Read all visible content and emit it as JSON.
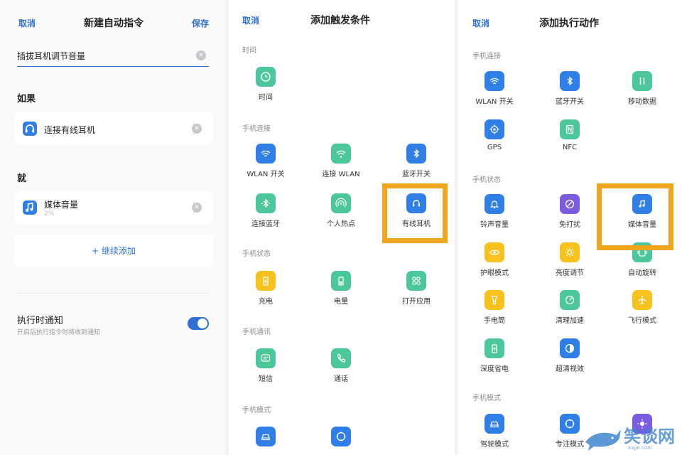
{
  "panel1": {
    "cancel": "取消",
    "title": "新建自动指令",
    "save": "保存",
    "command_name": "插拔耳机调节音量",
    "if_label": "如果",
    "trigger": {
      "label": "连接有线耳机"
    },
    "then_label": "就",
    "action": {
      "label": "媒体音量",
      "value": "2%"
    },
    "add_more": "+ 继续添加",
    "notify_title": "执行时通知",
    "notify_desc": "开启后执行指令时将收到通知",
    "notify_on": true
  },
  "panel2": {
    "cancel": "取消",
    "title": "添加触发条件",
    "sections": [
      {
        "name": "时间",
        "items": [
          {
            "label": "时间",
            "icon": "clock-icon",
            "color": "green"
          }
        ]
      },
      {
        "name": "手机连接",
        "items": [
          {
            "label": "WLAN 开关",
            "icon": "wifi-icon",
            "color": "blue"
          },
          {
            "label": "连接 WLAN",
            "icon": "wifi-connect-icon",
            "color": "green"
          },
          {
            "label": "蓝牙开关",
            "icon": "bluetooth-icon",
            "color": "blue"
          },
          {
            "label": "连接蓝牙",
            "icon": "bluetooth-connect-icon",
            "color": "green"
          },
          {
            "label": "个人热点",
            "icon": "hotspot-icon",
            "color": "green"
          },
          {
            "label": "有线耳机",
            "icon": "headset-icon",
            "color": "blue"
          }
        ]
      },
      {
        "name": "手机状态",
        "items": [
          {
            "label": "充电",
            "icon": "charging-icon",
            "color": "yellow"
          },
          {
            "label": "电量",
            "icon": "battery-icon",
            "color": "green"
          },
          {
            "label": "打开应用",
            "icon": "apps-icon",
            "color": "green"
          }
        ]
      },
      {
        "name": "手机通讯",
        "items": [
          {
            "label": "短信",
            "icon": "message-icon",
            "color": "green"
          },
          {
            "label": "通话",
            "icon": "phone-icon",
            "color": "green"
          }
        ]
      },
      {
        "name": "手机模式",
        "items": [
          {
            "label": "",
            "icon": "car-icon",
            "color": "blue"
          },
          {
            "label": "",
            "icon": "focus-icon",
            "color": "blue"
          }
        ]
      }
    ]
  },
  "panel3": {
    "cancel": "取消",
    "title": "添加执行动作",
    "sections": [
      {
        "name": "手机连接",
        "items": [
          {
            "label": "WLAN 开关",
            "icon": "wifi-icon",
            "color": "blue"
          },
          {
            "label": "蓝牙开关",
            "icon": "bluetooth-icon",
            "color": "blue"
          },
          {
            "label": "移动数据",
            "icon": "mobile-data-icon",
            "color": "green"
          },
          {
            "label": "GPS",
            "icon": "gps-icon",
            "color": "blue"
          },
          {
            "label": "NFC",
            "icon": "nfc-icon",
            "color": "green"
          }
        ]
      },
      {
        "name": "手机状态",
        "items": [
          {
            "label": "铃声音量",
            "icon": "bell-icon",
            "color": "blue"
          },
          {
            "label": "免打扰",
            "icon": "dnd-icon",
            "color": "purple"
          },
          {
            "label": "媒体音量",
            "icon": "music-note-icon",
            "color": "blue"
          },
          {
            "label": "护眼模式",
            "icon": "eye-icon",
            "color": "yellow"
          },
          {
            "label": "亮度调节",
            "icon": "brightness-icon",
            "color": "yellow"
          },
          {
            "label": "自动旋转",
            "icon": "rotate-icon",
            "color": "green"
          },
          {
            "label": "手电筒",
            "icon": "flashlight-icon",
            "color": "yellow"
          },
          {
            "label": "清理加速",
            "icon": "speedup-icon",
            "color": "green"
          },
          {
            "label": "飞行模式",
            "icon": "airplane-icon",
            "color": "yellow"
          },
          {
            "label": "深度省电",
            "icon": "power-save-icon",
            "color": "green"
          },
          {
            "label": "超清视效",
            "icon": "contrast-icon",
            "color": "blue"
          }
        ]
      },
      {
        "name": "手机模式",
        "items": [
          {
            "label": "驾驶模式",
            "icon": "car-icon",
            "color": "blue"
          },
          {
            "label": "专注模式",
            "icon": "focus-icon",
            "color": "blue"
          },
          {
            "label": "",
            "icon": "night-mode-icon",
            "color": "purple"
          }
        ]
      }
    ]
  },
  "watermark": {
    "text": "笑谈网",
    "url": "xajjn.com"
  },
  "colors": {
    "accent": "#2e6fd6",
    "highlight": "#f0a51e",
    "blue": "#2f7fe6",
    "green": "#4cc79a",
    "yellow": "#f7c21d",
    "purple": "#7b5ce0"
  }
}
